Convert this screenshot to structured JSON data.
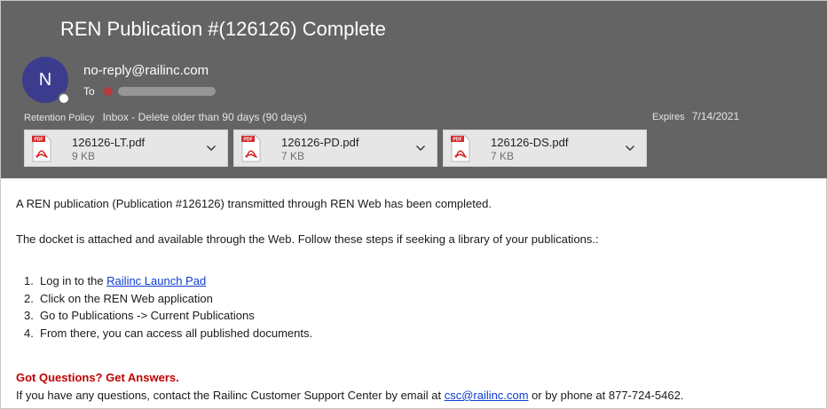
{
  "email": {
    "subject": "REN Publication #(126126) Complete",
    "avatar_initial": "N",
    "sender": "no-reply@railinc.com",
    "to_label": "To",
    "retention_label": "Retention Policy",
    "retention_value": "Inbox - Delete older than 90 days (90 days)",
    "expires_label": "Expires",
    "expires_value": "7/14/2021"
  },
  "attachments": [
    {
      "name": "126126-LT.pdf",
      "size": "9 KB",
      "icon": "pdf-icon"
    },
    {
      "name": "126126-PD.pdf",
      "size": "7 KB",
      "icon": "pdf-icon"
    },
    {
      "name": "126126-DS.pdf",
      "size": "7 KB",
      "icon": "pdf-icon"
    }
  ],
  "body": {
    "intro": "A REN publication (Publication #126126) transmitted through REN Web has been completed.",
    "docket_line": "The docket is attached and available through the Web. Follow these steps if seeking a library of your publications.:",
    "steps": [
      {
        "num": "1.",
        "prefix": "Log in to the ",
        "link": "Railinc Launch Pad"
      },
      {
        "num": "2.",
        "text": "Click on the REN Web application"
      },
      {
        "num": "3.",
        "text": "Go to Publications -> Current Publications"
      },
      {
        "num": "4.",
        "text": "From there, you can access all published documents."
      }
    ],
    "questions_heading": "Got Questions? Get Answers.",
    "contact_prefix": "If you have any questions, contact the Railinc Customer Support Center by email at ",
    "contact_email": "csc@railinc.com",
    "contact_suffix": " or by phone at 877-724-5462."
  },
  "colors": {
    "header_bg": "#646464",
    "avatar_bg": "#3c3c8e",
    "link": "#0b3bd1",
    "heading_red": "#c00000",
    "pdf_red": "#d42a2a"
  }
}
